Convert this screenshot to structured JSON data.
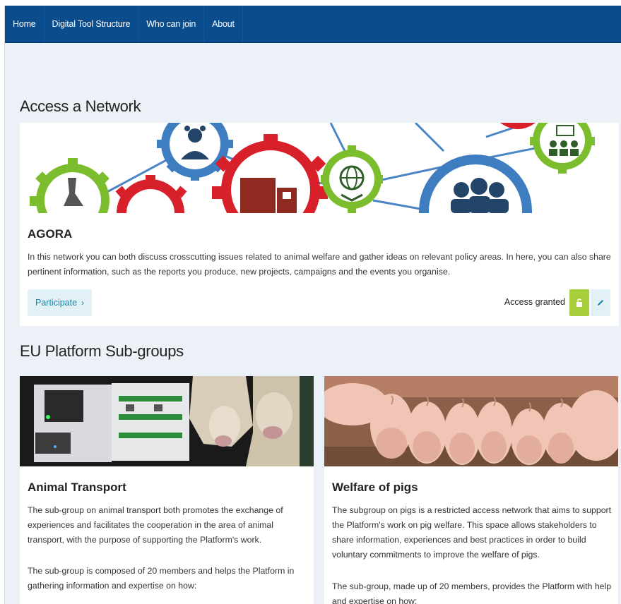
{
  "nav": {
    "items": [
      "Home",
      "Digital Tool Structure",
      "Who can join",
      "About"
    ]
  },
  "sections": {
    "network_title": "Access a Network",
    "subgroups_title": "EU Platform Sub-groups"
  },
  "agora": {
    "title": "AGORA",
    "description": "In this network you can both discuss crosscutting issues related to animal welfare and gather ideas on relevant policy areas. In here, you can also share pertinent information, such as the reports you produce, new projects, campaigns and the events you organise.",
    "participate_label": "Participate",
    "access_status": "Access granted"
  },
  "subgroups": [
    {
      "title": "Animal Transport",
      "paragraph1": "The sub-group on animal transport both promotes the exchange of experiences and facilitates the cooperation in the area of animal transport, with the purpose of supporting the Platform's work.",
      "paragraph2": "The sub-group is composed of 20 members and helps the Platform in gathering information and expertise on how:"
    },
    {
      "title": "Welfare of pigs",
      "paragraph1": "The subgroup on pigs is a restricted access network that aims to support the Platform's work on pig welfare. This space allows stakeholders to share information, experiences and best practices in order to build voluntary commitments to improve the welfare of pigs.",
      "paragraph2": "The sub-group, made up of 20 members, provides the Platform with help and expertise on how:"
    }
  ],
  "icons": {
    "participate_chevron": "chevron-right-icon",
    "lock": "unlock-icon",
    "edit": "pencil-icon"
  },
  "colors": {
    "navbar": "#0a4c8c",
    "page_bg": "#ecf1f8",
    "access_green": "#a7cf3b",
    "button_light": "#e1f1f5",
    "link_teal": "#1a86a8"
  }
}
